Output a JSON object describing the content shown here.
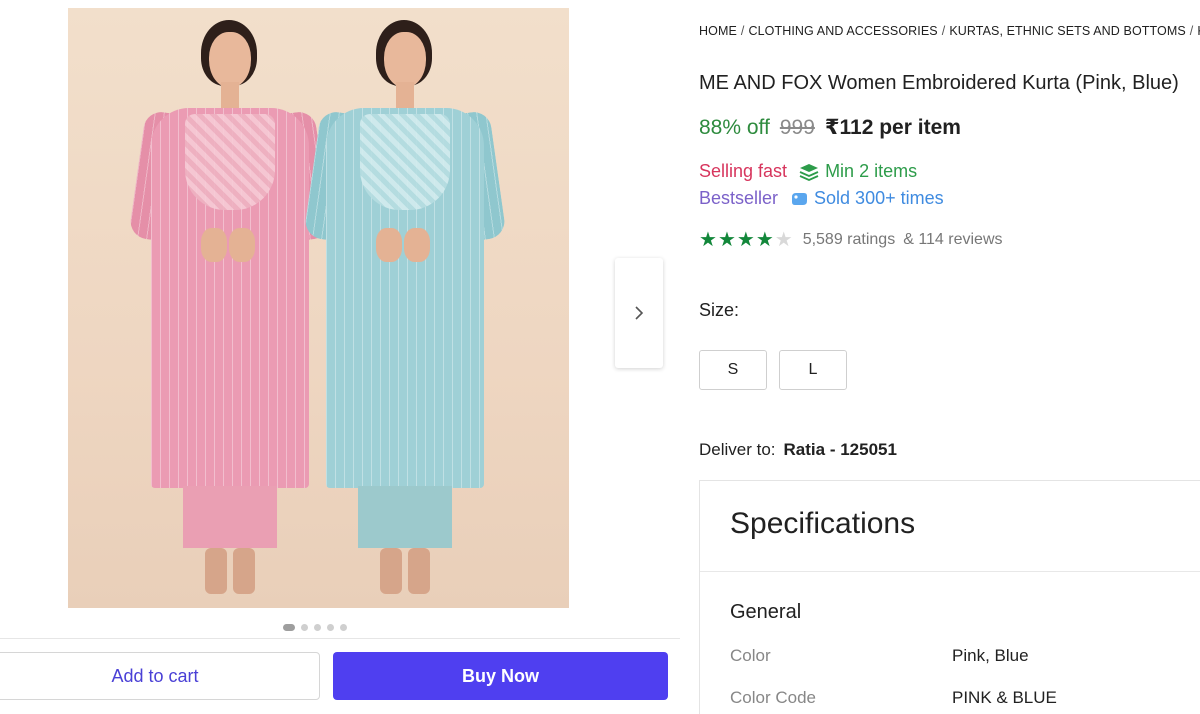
{
  "gallery": {
    "image_alt": "Two models wearing embroidered kurtas in pink and blue",
    "dots_count": 5,
    "active_dot": 0,
    "next_icon": "chevron-right-icon"
  },
  "actions": {
    "add_to_cart": "Add to cart",
    "buy_now": "Buy Now"
  },
  "breadcrumb": {
    "items": [
      "HOME",
      "CLOTHING AND ACCESSORIES",
      "KURTAS, ETHNIC SETS AND BOTTOMS",
      "KU"
    ],
    "separator": "/"
  },
  "product": {
    "title": "ME AND FOX Women Embroidered Kurta (Pink, Blue)",
    "discount": "88% off",
    "mrp": "999",
    "price": "₹112",
    "price_unit": "per item"
  },
  "badges": {
    "selling_fast": "Selling fast",
    "min_items": "Min 2 items",
    "bestseller": "Bestseller",
    "sold": "Sold 300+ times"
  },
  "rating": {
    "stars": 4,
    "max_stars": 5,
    "ratings_text": "5,589 ratings",
    "reviews_text": "& 114 reviews"
  },
  "size": {
    "label": "Size:",
    "options": [
      "S",
      "L"
    ]
  },
  "delivery": {
    "label": "Deliver to:",
    "location": "Ratia - 125051"
  },
  "specifications": {
    "title": "Specifications",
    "section": "General",
    "rows": [
      {
        "key": "Color",
        "value": "Pink, Blue"
      },
      {
        "key": "Color Code",
        "value": "PINK & BLUE"
      }
    ]
  },
  "colors": {
    "accent": "#4f3ff0",
    "discount": "#2e8b3e",
    "selling_fast": "#d7355d",
    "bestseller": "#7b61c9",
    "sold": "#3f8be0",
    "star": "#12873a"
  }
}
